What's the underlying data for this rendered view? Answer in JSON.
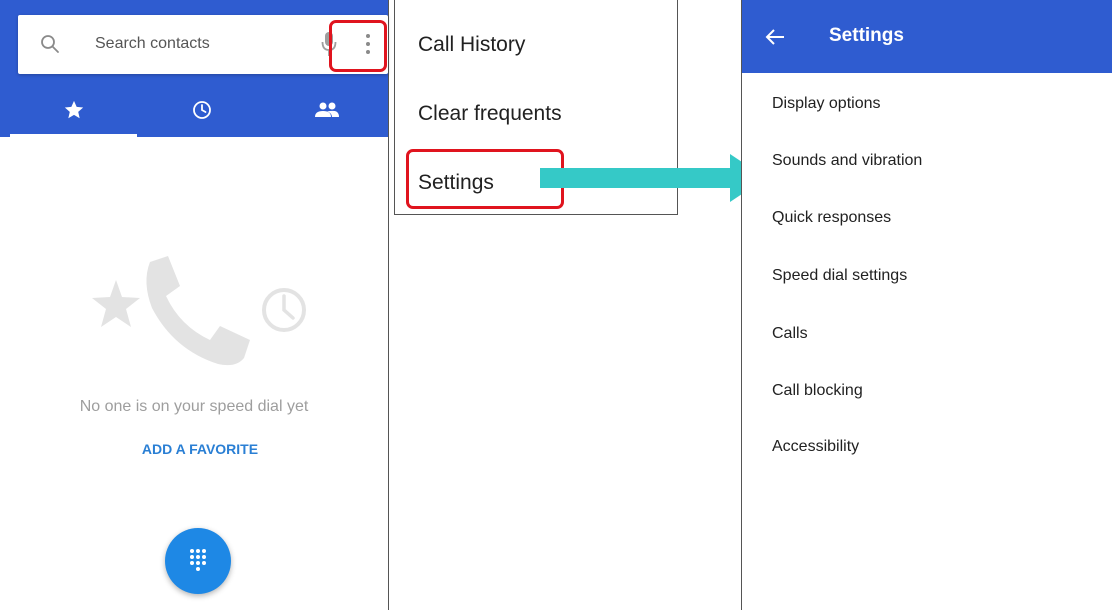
{
  "dialer": {
    "search_placeholder": "Search contacts",
    "tabs": [
      {
        "name": "speed-dial",
        "icon": "star-icon",
        "selected": true
      },
      {
        "name": "recents",
        "icon": "clock-icon",
        "selected": false
      },
      {
        "name": "contacts",
        "icon": "people-icon",
        "selected": false
      }
    ],
    "empty_message": "No one is on your speed dial yet",
    "add_favorite_label": "ADD A FAVORITE"
  },
  "menu": {
    "items": [
      "Call History",
      "Clear frequents",
      "Settings"
    ]
  },
  "settings": {
    "title": "Settings",
    "items": [
      "Display options",
      "Sounds and vibration",
      "Quick responses",
      "Speed dial settings",
      "Calls",
      "Call blocking",
      "Accessibility"
    ]
  },
  "colors": {
    "primary": "#2f5cd0",
    "highlight": "#e0141e",
    "arrow": "#35c9c7",
    "accent": "#2a7fd4"
  }
}
